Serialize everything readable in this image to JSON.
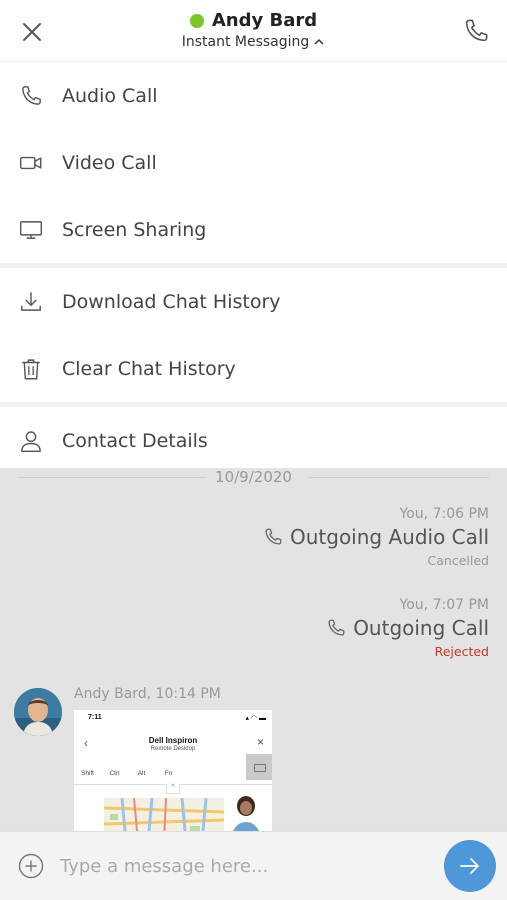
{
  "header": {
    "contact_name": "Andy Bard",
    "presence": "online",
    "presence_color": "#7ac62a",
    "mode_label": "Instant Messaging",
    "icons": {
      "close": "close-icon",
      "call": "phone-icon",
      "mode_toggle": "chevron-up-icon"
    }
  },
  "menu": {
    "groups": [
      [
        {
          "label": "Audio Call",
          "icon": "phone-icon"
        },
        {
          "label": "Video Call",
          "icon": "video-camera-icon"
        },
        {
          "label": "Screen Sharing",
          "icon": "monitor-icon"
        }
      ],
      [
        {
          "label": "Download Chat History",
          "icon": "download-icon"
        },
        {
          "label": "Clear Chat History",
          "icon": "trash-icon"
        }
      ],
      [
        {
          "label": "Contact Details",
          "icon": "user-icon"
        }
      ]
    ]
  },
  "chat": {
    "date_separator": "10/9/2020",
    "messages": [
      {
        "direction": "outgoing",
        "meta": "You, 7:06 PM",
        "text": "Outgoing Audio Call",
        "status": "Cancelled",
        "status_color": "#999999",
        "icon": "phone-icon"
      },
      {
        "direction": "outgoing",
        "meta": "You, 7:07 PM",
        "text": "Outgoing Call",
        "status": "Rejected",
        "status_color": "#c0392b",
        "icon": "phone-icon"
      },
      {
        "direction": "incoming",
        "meta": "Andy Bard, 10:14 PM",
        "attachment": {
          "type": "screenshot",
          "status_time": "7:11",
          "title": "Dell Inspiron",
          "subtitle": "Remote Desktop",
          "keys": [
            "Shift",
            "Ctrl",
            "Alt",
            "Fn"
          ]
        }
      }
    ]
  },
  "composer": {
    "placeholder": "Type a message here...",
    "value": "",
    "send_color": "#4e97d8"
  }
}
